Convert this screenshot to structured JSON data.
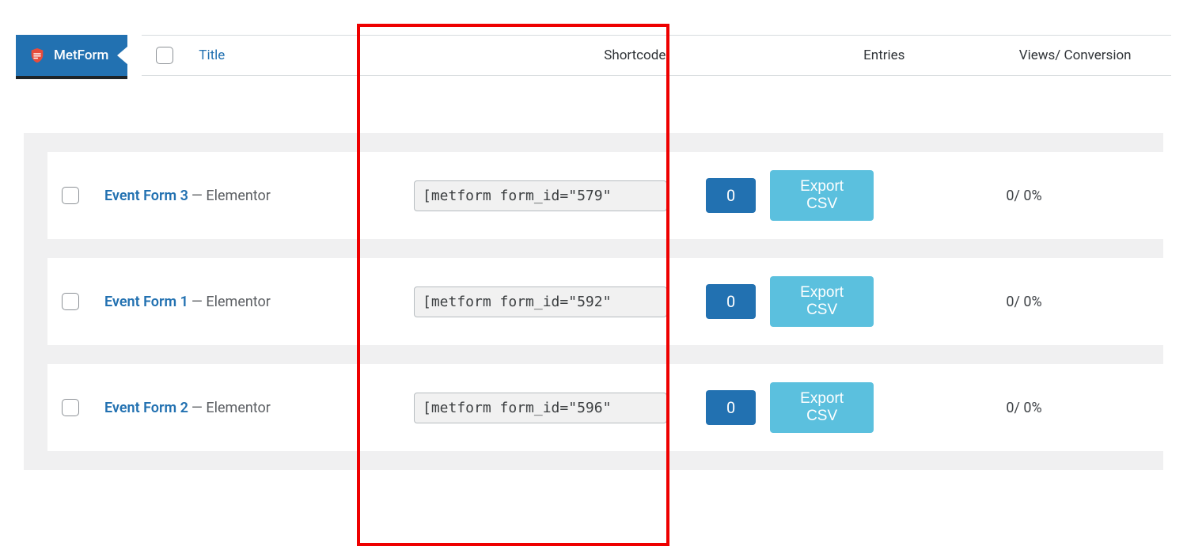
{
  "tab": {
    "label": "MetForm"
  },
  "headers": {
    "title": "Title",
    "shortcode": "Shortcode",
    "entries": "Entries",
    "views": "Views/ Conversion"
  },
  "rows": [
    {
      "title": "Event Form 3",
      "suffix": "— Elementor",
      "shortcode": "[metform form_id=\"579\"",
      "entries": "0",
      "export_label": "Export CSV",
      "views": "0/ 0%"
    },
    {
      "title": "Event Form 1",
      "suffix": "— Elementor",
      "shortcode": "[metform form_id=\"592\"",
      "entries": "0",
      "export_label": "Export CSV",
      "views": "0/ 0%"
    },
    {
      "title": "Event Form 2",
      "suffix": "— Elementor",
      "shortcode": "[metform form_id=\"596\"",
      "entries": "0",
      "export_label": "Export CSV",
      "views": "0/ 0%"
    }
  ]
}
